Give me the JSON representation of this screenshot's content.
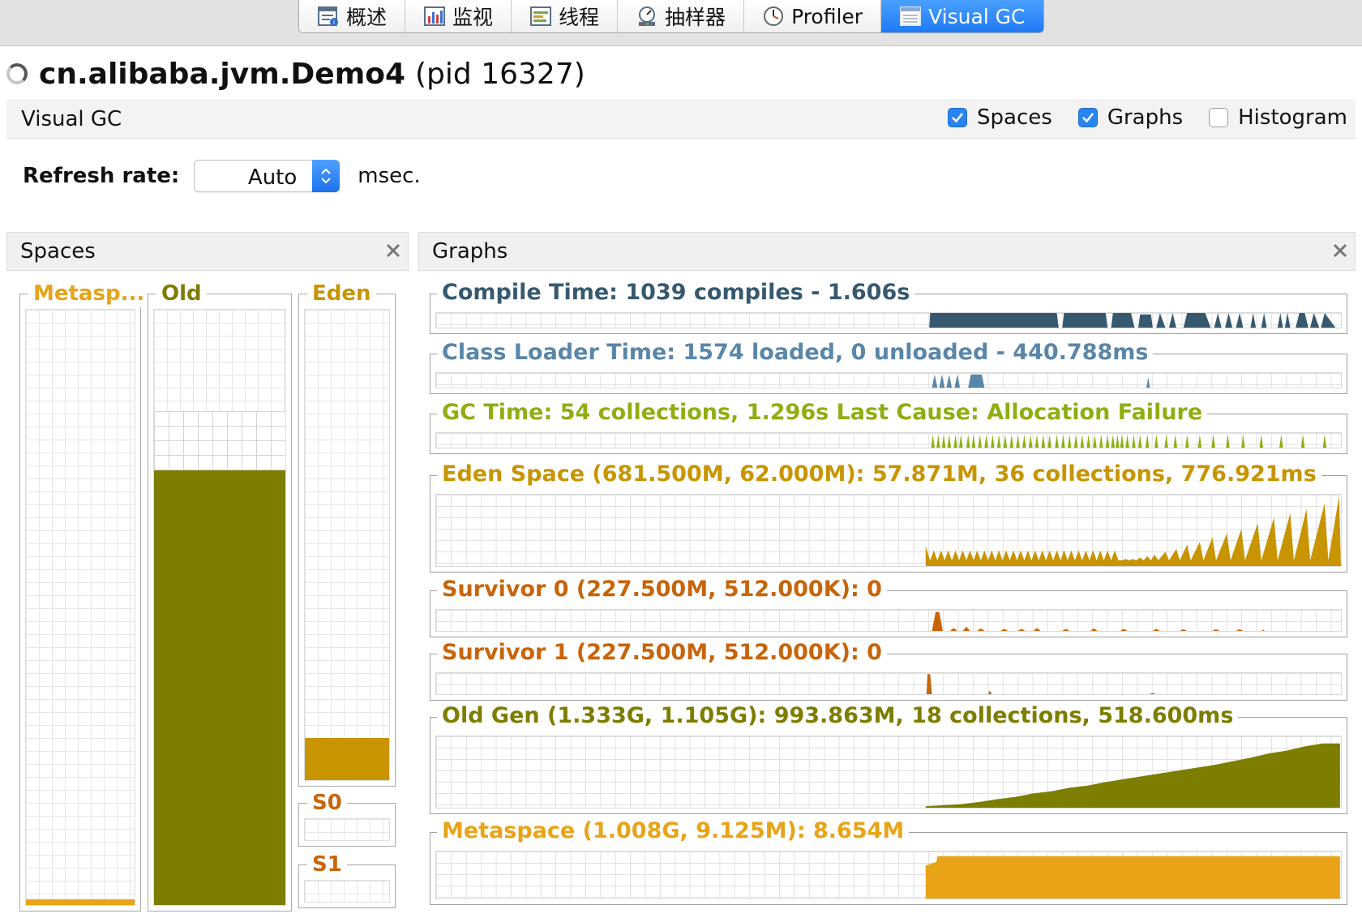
{
  "tabs": [
    {
      "label": "概述",
      "icon": "overview-icon"
    },
    {
      "label": "监视",
      "icon": "monitor-icon"
    },
    {
      "label": "线程",
      "icon": "threads-icon"
    },
    {
      "label": "抽样器",
      "icon": "sampler-icon"
    },
    {
      "label": "Profiler",
      "icon": "profiler-icon"
    },
    {
      "label": "Visual GC",
      "icon": "visual-gc-icon",
      "active": true
    }
  ],
  "app": {
    "title": "cn.alibaba.jvm.Demo4",
    "pid": "(pid 16327)"
  },
  "visual_gc": {
    "label": "Visual GC",
    "options": [
      {
        "label": "Spaces",
        "checked": true
      },
      {
        "label": "Graphs",
        "checked": true
      },
      {
        "label": "Histogram",
        "checked": false
      }
    ]
  },
  "refresh": {
    "label": "Refresh rate:",
    "value": "Auto",
    "unit": "msec."
  },
  "spaces_panel": {
    "title": "Spaces",
    "metaspace": {
      "label": "Metasp...",
      "color": "#e8a317",
      "fill_fraction": 0.01
    },
    "old": {
      "label": "Old",
      "color": "#7d7d00",
      "reserved_fraction": 0.83,
      "fill_fraction": 0.73
    },
    "eden": {
      "label": "Eden",
      "color": "#c89400",
      "fill_fraction": 0.09
    },
    "s0": {
      "label": "S0",
      "color": "#c8640a",
      "fill_fraction": 0
    },
    "s1": {
      "label": "S1",
      "color": "#c8640a",
      "fill_fraction": 0
    }
  },
  "graphs_panel": {
    "title": "Graphs",
    "compile_time": {
      "label": "Compile Time: 1039 compiles - 1.606s",
      "color": "#36596f"
    },
    "class_loader": {
      "label": "Class Loader Time: 1574 loaded, 0 unloaded - 440.788ms",
      "color": "#5986a9"
    },
    "gc_time": {
      "label": "GC Time: 54 collections, 1.296s  Last Cause: Allocation Failure",
      "color": "#8fae11"
    },
    "eden": {
      "label": "Eden Space (681.500M, 62.000M): 57.871M, 36 collections, 776.921ms",
      "color": "#c89400"
    },
    "survivor0": {
      "label": "Survivor 0 (227.500M, 512.000K): 0",
      "color": "#c8640a"
    },
    "survivor1": {
      "label": "Survivor 1 (227.500M, 512.000K): 0",
      "color": "#c8640a"
    },
    "old_gen": {
      "label": "Old Gen (1.333G, 1.105G): 993.863M, 18 collections, 518.600ms",
      "color": "#7d7d00"
    },
    "metaspace": {
      "label": "Metaspace (1.008G, 9.125M): 8.654M",
      "color": "#e8a317"
    }
  }
}
